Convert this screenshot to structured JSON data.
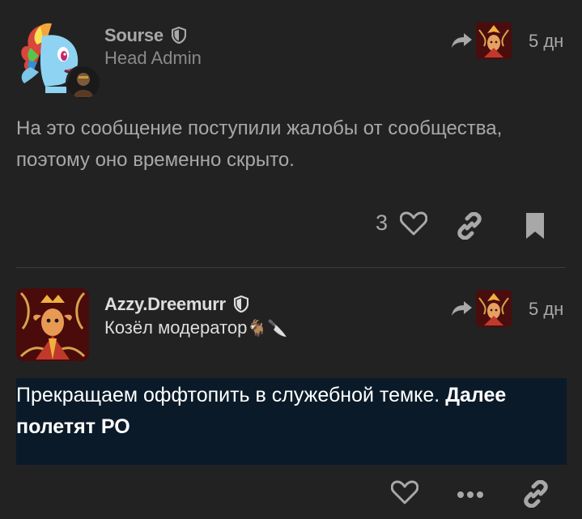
{
  "posts": [
    {
      "username": "Sourse",
      "title": "Head Admin",
      "date": "5 дн",
      "body": "На это сообщение поступили жалобы от сообщества, поэтому оно временно скрыто.",
      "like_count": "3"
    },
    {
      "username": "Azzy.Dreemurr",
      "title": "Козёл модератор",
      "title_emoji": "🐐🔪",
      "date": "5 дн",
      "body_normal": "Прекращаем оффтопить в служебной темке. ",
      "body_bold": "Далее полетят РО"
    }
  ],
  "colors": {
    "background": "#222222",
    "text_primary": "#dddddd",
    "text_muted": "#a8a8a8",
    "highlight_bg": "#0b1a28",
    "icon": "#a8a8a8"
  },
  "icons": [
    "shield-icon",
    "reply-arrow-icon",
    "heart-icon",
    "link-icon",
    "bookmark-icon",
    "more-icon"
  ]
}
